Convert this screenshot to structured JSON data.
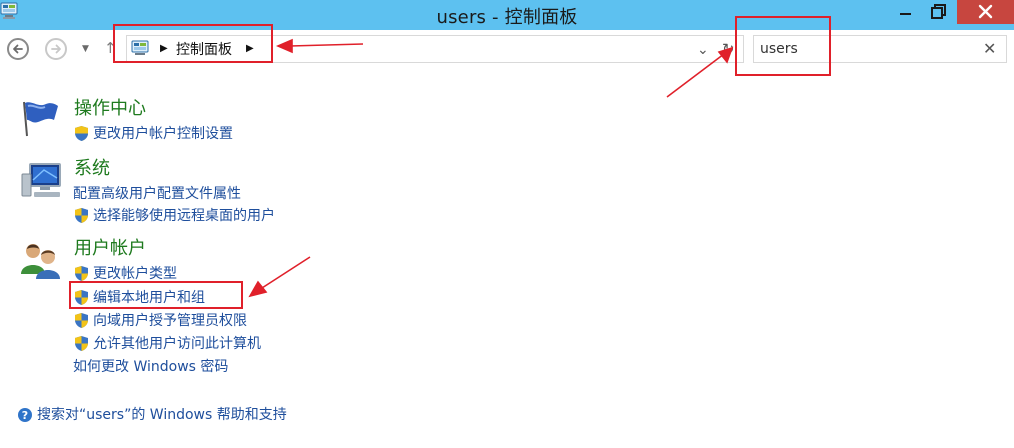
{
  "window": {
    "title": "users - 控制面板"
  },
  "address_bar": {
    "breadcrumb": "控制面板"
  },
  "search": {
    "value": "users"
  },
  "results": {
    "action_center": {
      "title": "操作中心",
      "links": [
        "更改用户帐户控制设置"
      ]
    },
    "system": {
      "title": "系统",
      "links": [
        "配置高级用户配置文件属性",
        "选择能够使用远程桌面的用户"
      ]
    },
    "user_accounts": {
      "title": "用户帐户",
      "links": [
        "更改帐户类型",
        "编辑本地用户和组",
        "向域用户授予管理员权限",
        "允许其他用户访问此计算机",
        "如何更改 Windows 密码"
      ]
    }
  },
  "help_link": "搜索对“users”的 Windows 帮助和支持",
  "colors": {
    "titlebar": "#5dc1f0",
    "close_button": "#c7463f",
    "category_title": "#1e7a1e",
    "link": "#1e4e9c",
    "annotation": "#e0202a"
  },
  "icons": [
    "control-panel-icon",
    "action-center-flag-icon",
    "system-monitor-icon",
    "user-accounts-icon",
    "uac-shield-icon",
    "help-icon"
  ]
}
